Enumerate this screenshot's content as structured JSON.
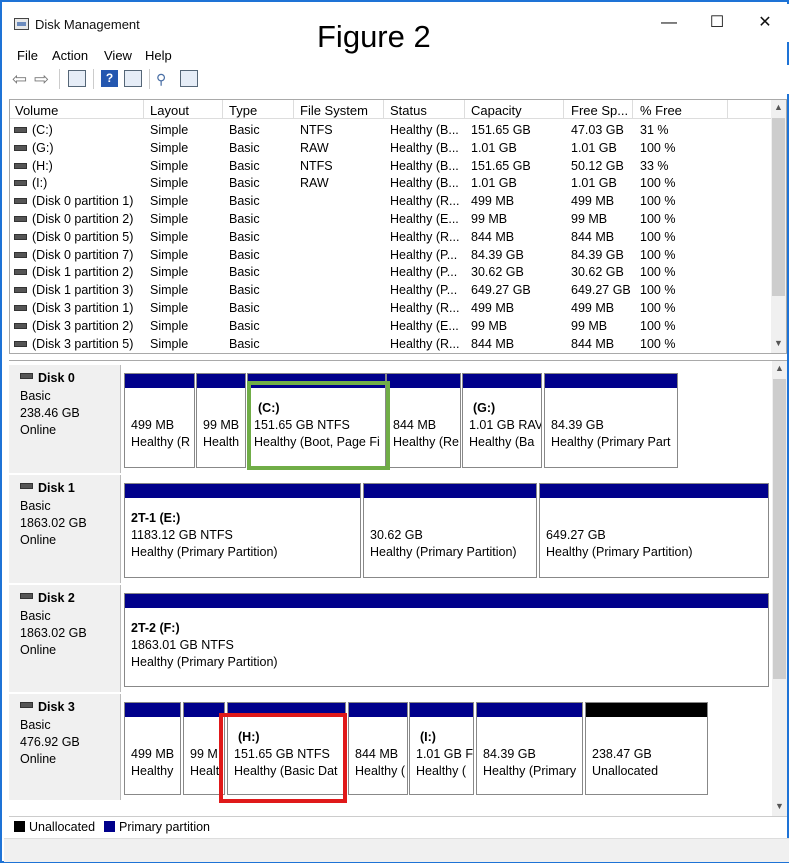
{
  "window": {
    "title": "Disk Management",
    "figure_label": "Figure 2",
    "minimize": "—",
    "maximize": "☐",
    "close": "✕"
  },
  "menu": [
    "File",
    "Action",
    "View",
    "Help"
  ],
  "columns": [
    "Volume",
    "Layout",
    "Type",
    "File System",
    "Status",
    "Capacity",
    "Free Sp...",
    "% Free"
  ],
  "volumes": [
    {
      "volume": "(C:)",
      "layout": "Simple",
      "type": "Basic",
      "fs": "NTFS",
      "status": "Healthy (B...",
      "capacity": "151.65 GB",
      "free": "47.03 GB",
      "pct": "31 %"
    },
    {
      "volume": "(G:)",
      "layout": "Simple",
      "type": "Basic",
      "fs": "RAW",
      "status": "Healthy (B...",
      "capacity": "1.01 GB",
      "free": "1.01 GB",
      "pct": "100 %"
    },
    {
      "volume": "(H:)",
      "layout": "Simple",
      "type": "Basic",
      "fs": "NTFS",
      "status": "Healthy (B...",
      "capacity": "151.65 GB",
      "free": "50.12 GB",
      "pct": "33 %"
    },
    {
      "volume": "(I:)",
      "layout": "Simple",
      "type": "Basic",
      "fs": "RAW",
      "status": "Healthy (B...",
      "capacity": "1.01 GB",
      "free": "1.01 GB",
      "pct": "100 %"
    },
    {
      "volume": "(Disk 0 partition 1)",
      "layout": "Simple",
      "type": "Basic",
      "fs": "",
      "status": "Healthy (R...",
      "capacity": "499 MB",
      "free": "499 MB",
      "pct": "100 %"
    },
    {
      "volume": "(Disk 0 partition 2)",
      "layout": "Simple",
      "type": "Basic",
      "fs": "",
      "status": "Healthy (E...",
      "capacity": "99 MB",
      "free": "99 MB",
      "pct": "100 %"
    },
    {
      "volume": "(Disk 0 partition 5)",
      "layout": "Simple",
      "type": "Basic",
      "fs": "",
      "status": "Healthy (R...",
      "capacity": "844 MB",
      "free": "844 MB",
      "pct": "100 %"
    },
    {
      "volume": "(Disk 0 partition 7)",
      "layout": "Simple",
      "type": "Basic",
      "fs": "",
      "status": "Healthy (P...",
      "capacity": "84.39 GB",
      "free": "84.39 GB",
      "pct": "100 %"
    },
    {
      "volume": "(Disk 1 partition 2)",
      "layout": "Simple",
      "type": "Basic",
      "fs": "",
      "status": "Healthy (P...",
      "capacity": "30.62 GB",
      "free": "30.62 GB",
      "pct": "100 %"
    },
    {
      "volume": "(Disk 1 partition 3)",
      "layout": "Simple",
      "type": "Basic",
      "fs": "",
      "status": "Healthy (P...",
      "capacity": "649.27 GB",
      "free": "649.27 GB",
      "pct": "100 %"
    },
    {
      "volume": "(Disk 3 partition 1)",
      "layout": "Simple",
      "type": "Basic",
      "fs": "",
      "status": "Healthy (R...",
      "capacity": "499 MB",
      "free": "499 MB",
      "pct": "100 %"
    },
    {
      "volume": "(Disk 3 partition 2)",
      "layout": "Simple",
      "type": "Basic",
      "fs": "",
      "status": "Healthy (E...",
      "capacity": "99 MB",
      "free": "99 MB",
      "pct": "100 %"
    },
    {
      "volume": "(Disk 3 partition 5)",
      "layout": "Simple",
      "type": "Basic",
      "fs": "",
      "status": "Healthy (R...",
      "capacity": "844 MB",
      "free": "844 MB",
      "pct": "100 %"
    }
  ],
  "disks": [
    {
      "name": "Disk 0",
      "type": "Basic",
      "size": "238.46 GB",
      "state": "Online",
      "partitions": [
        {
          "title": "",
          "line1": "499 MB",
          "line2": "Healthy (R"
        },
        {
          "title": "",
          "line1": "99 MB",
          "line2": "Health"
        },
        {
          "title": "(C:)",
          "line1": "151.65 GB NTFS",
          "line2": "Healthy (Boot, Page Fi"
        },
        {
          "title": "",
          "line1": "844 MB",
          "line2": "Healthy (Re"
        },
        {
          "title": "(G:)",
          "line1": "1.01 GB RAV",
          "line2": "Healthy (Ba"
        },
        {
          "title": "",
          "line1": "84.39 GB",
          "line2": "Healthy (Primary Part"
        }
      ]
    },
    {
      "name": "Disk 1",
      "type": "Basic",
      "size": "1863.02 GB",
      "state": "Online",
      "partitions": [
        {
          "title": "2T-1  (E:)",
          "line1": "1183.12 GB NTFS",
          "line2": "Healthy (Primary Partition)"
        },
        {
          "title": "",
          "line1": "30.62 GB",
          "line2": "Healthy (Primary Partition)"
        },
        {
          "title": "",
          "line1": "649.27 GB",
          "line2": "Healthy (Primary Partition)"
        }
      ]
    },
    {
      "name": "Disk 2",
      "type": "Basic",
      "size": "1863.02 GB",
      "state": "Online",
      "partitions": [
        {
          "title": "2T-2  (F:)",
          "line1": "1863.01 GB NTFS",
          "line2": "Healthy (Primary Partition)"
        }
      ]
    },
    {
      "name": "Disk 3",
      "type": "Basic",
      "size": "476.92 GB",
      "state": "Online",
      "partitions": [
        {
          "title": "",
          "line1": "499 MB",
          "line2": "Healthy"
        },
        {
          "title": "",
          "line1": "99 M",
          "line2": "Healt"
        },
        {
          "title": "(H:)",
          "line1": "151.65 GB NTFS",
          "line2": "Healthy (Basic Dat"
        },
        {
          "title": "",
          "line1": "844 MB",
          "line2": "Healthy ("
        },
        {
          "title": "(I:)",
          "line1": "1.01 GB F",
          "line2": "Healthy ("
        },
        {
          "title": "",
          "line1": "84.39 GB",
          "line2": "Healthy (Primary"
        },
        {
          "title": "",
          "line1": "238.47 GB",
          "line2": "Unallocated"
        }
      ]
    }
  ],
  "legend": {
    "unallocated": "Unallocated",
    "primary": "Primary partition"
  },
  "colors": {
    "primary": "#00008b",
    "unallocated": "#000000",
    "highlight_c": "#70ad47",
    "highlight_h": "#e0191a"
  }
}
